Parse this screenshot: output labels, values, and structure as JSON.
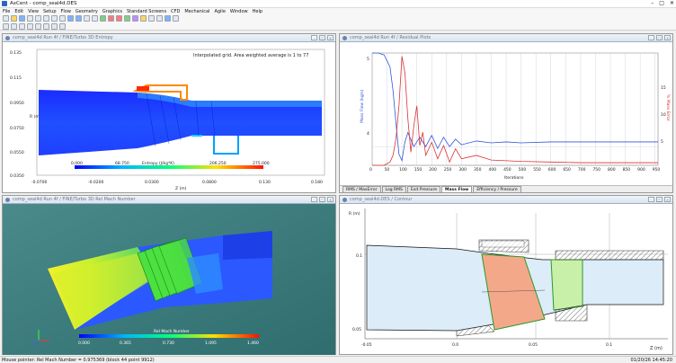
{
  "window": {
    "title": "AxCent - comp_seal4d.DES",
    "minimize": "–",
    "maximize": "□",
    "close": "✕"
  },
  "menu": [
    "File",
    "Edit",
    "View",
    "Setup",
    "Flow",
    "Geometry",
    "Graphics",
    "Standard Screens",
    "CFD",
    "Mechanical",
    "Agile",
    "Window",
    "Help"
  ],
  "toolbar_icons": [
    "new-icon",
    "open-icon",
    "save-icon",
    "print-icon",
    "cut-icon",
    "copy-icon",
    "paste-icon",
    "undo-icon",
    "zoom-icon",
    "rotate-icon",
    "pan-icon",
    "fit-icon",
    "grid-icon",
    "color-icon",
    "run-icon",
    "stop-icon",
    "chart-icon",
    "help-icon"
  ],
  "panels": {
    "entropy": {
      "title": "comp_seal4d Run 4f / FINE/Turbo 3D Entropy",
      "note": "Interpolated grid.  Area weighted average  is 1 to 77",
      "y_ticks": [
        "0.135",
        "0.115",
        "0.0950",
        "0.0750",
        "0.0550",
        "0.0350"
      ],
      "x_ticks": [
        "-0.0700",
        "-0.0200",
        "0.0300",
        "0.0800",
        "0.130",
        "0.180"
      ],
      "y_axis": "R (m)",
      "x_axis": "Z (m)",
      "colorbar_title": "Entropy (J/kg*K)",
      "colorbar_ticks": [
        "0.000",
        "68.750",
        "137.500",
        "206.250",
        "275.000"
      ]
    },
    "residual": {
      "title": "comp_seal4d Run 4f / Residual Plots",
      "y_axis": "Mass Flow (kg/s)",
      "y_axis_right": "% Mass Error",
      "x_axis": "Iterations",
      "y_ticks": [
        "5",
        "4"
      ],
      "y_ticks_right": [
        "15",
        "10",
        "5"
      ],
      "x_ticks": [
        "0",
        "50",
        "100",
        "150",
        "200",
        "250",
        "300",
        "350",
        "400",
        "450",
        "500",
        "550",
        "600",
        "650",
        "700",
        "750",
        "800",
        "850",
        "900",
        "950"
      ],
      "tabs": [
        "RMS / MaxError",
        "Log RMS",
        "Exit Pressure",
        "Mass Flow",
        "Efficiency / Pressure"
      ],
      "active_tab": "Mass Flow"
    },
    "mach": {
      "title": "comp_seal4d Run 4f / FINE/Turbo 3D Rel Mach Number",
      "colorbar_title": "Rel Mach Number",
      "colorbar_ticks": [
        "0.000",
        "0.365",
        "0.730",
        "1.095",
        "1.460"
      ]
    },
    "contour": {
      "title": "comp_seal4d.DES / Contour",
      "y_axis": "R (m)",
      "y_ticks": [
        "0.1",
        "0.05"
      ],
      "x_axis": "Z (m)",
      "x_ticks": [
        "-0.05",
        "0.0",
        "0.05",
        "0.1"
      ]
    }
  },
  "status": {
    "left": "Mouse pointer:  Rel Mach Number = 0.975369  (block 44 point 9912)",
    "right": "01/20/26  14:45:20"
  },
  "chart_data": [
    {
      "type": "line",
      "title": "",
      "xlabel": "Iterations",
      "ylabel": "Mass Flow (kg/s)",
      "y2label": "% Mass Error",
      "xlim": [
        0,
        960
      ],
      "ylim": [
        3.8,
        5.0
      ],
      "y2lim": [
        0,
        17
      ],
      "series": [
        {
          "name": "Mass Flow",
          "color": "#3355dd",
          "x": [
            0,
            20,
            40,
            60,
            70,
            80,
            90,
            100,
            110,
            120,
            140,
            160,
            180,
            200,
            220,
            240,
            260,
            280,
            300,
            350,
            400,
            450,
            500,
            600,
            700,
            800,
            900,
            960
          ],
          "y": [
            5.0,
            5.0,
            4.98,
            4.85,
            4.6,
            4.25,
            3.92,
            3.85,
            4.05,
            4.15,
            4.0,
            4.1,
            4.0,
            4.12,
            3.98,
            4.1,
            4.0,
            4.08,
            4.02,
            4.06,
            4.04,
            4.05,
            4.04,
            4.05,
            4.05,
            4.05,
            4.05,
            4.05
          ]
        },
        {
          "name": "% Mass Error",
          "color": "#dd3333",
          "x": [
            0,
            40,
            60,
            70,
            80,
            90,
            100,
            110,
            120,
            130,
            140,
            150,
            160,
            170,
            180,
            200,
            220,
            240,
            260,
            280,
            300,
            350,
            400,
            500,
            600,
            700,
            800,
            900,
            960
          ],
          "y": [
            0,
            0,
            0.5,
            1.5,
            4,
            9,
            16.5,
            14,
            7,
            2,
            6,
            9,
            3,
            5,
            1.5,
            3.5,
            1,
            3,
            0.5,
            2.5,
            1,
            1.5,
            0.8,
            0.6,
            0.5,
            0.4,
            0.4,
            0.4,
            0.4
          ]
        }
      ]
    }
  ]
}
